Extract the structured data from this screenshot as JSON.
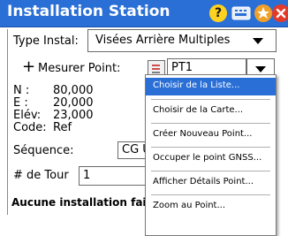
{
  "window": {
    "title": "Installation Station"
  },
  "titlebar_icons": {
    "help": "?",
    "keyboard": "keyboard-icon",
    "favorite": "star-icon",
    "close": "close-icon"
  },
  "form": {
    "type_label": "Type Instal:",
    "type_value": "Visées Arrière Multiples",
    "measure_label": "Mesurer Point:",
    "point_value": "PT1",
    "n_label": "N :",
    "n_value": "80,000",
    "e_label": "E :",
    "e_value": "20,000",
    "elev_label": "Elév:",
    "elev_value": "23,000",
    "code_label": "Code:",
    "code_value": "Ref",
    "sequence_label": "Séquence:",
    "sequence_value": "CG U",
    "tour_label": "# de Tour",
    "tour_value": "1",
    "status_text": "Aucune installation faite"
  },
  "menu": {
    "items": [
      "Choisir de la Liste...",
      "Choisir de la Carte...",
      "Créer Nouveau Point...",
      "Occuper le point GNSS...",
      "Afficher Détails Point...",
      "Zoom au Point..."
    ]
  },
  "colors": {
    "titlebar": "#2a6fd6",
    "selected": "#2a6fd6"
  }
}
